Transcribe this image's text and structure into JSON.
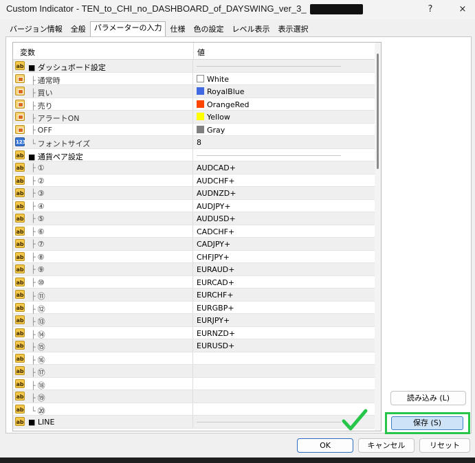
{
  "window": {
    "title": "Custom Indicator - TEN_to_CHI_no_DASHBOARD_of_DAYSWING_ver_3_",
    "help": "?",
    "close": "×"
  },
  "tabs": [
    {
      "label": "バージョン情報"
    },
    {
      "label": "全般"
    },
    {
      "label": "パラメーターの入力",
      "active": true
    },
    {
      "label": "仕様"
    },
    {
      "label": "色の設定"
    },
    {
      "label": "レベル表示"
    },
    {
      "label": "表示選択"
    }
  ],
  "grid": {
    "col_variable": "変数",
    "col_value": "値",
    "rows": [
      {
        "icon": "ab",
        "name": "■ ダッシュボード設定",
        "sub": false,
        "type": "line",
        "value": ""
      },
      {
        "icon": "color",
        "name": "通常時",
        "branch": "├",
        "sub": true,
        "type": "color",
        "swatch": "#ffffff",
        "value": "White"
      },
      {
        "icon": "color",
        "name": "買い",
        "branch": "├",
        "sub": true,
        "type": "color",
        "swatch": "#4169e1",
        "value": "RoyalBlue"
      },
      {
        "icon": "color",
        "name": "売り",
        "branch": "├",
        "sub": true,
        "type": "color",
        "swatch": "#ff4500",
        "value": "OrangeRed"
      },
      {
        "icon": "color",
        "name": "アラートON",
        "branch": "├",
        "sub": true,
        "type": "color",
        "swatch": "#ffff00",
        "value": "Yellow"
      },
      {
        "icon": "color",
        "name": "OFF",
        "branch": "├",
        "sub": true,
        "type": "color",
        "swatch": "#808080",
        "value": "Gray"
      },
      {
        "icon": "123",
        "name": "フォントサイズ",
        "branch": "└",
        "sub": true,
        "type": "text",
        "value": "8"
      },
      {
        "icon": "ab",
        "name": "■ 通貨ペア設定",
        "sub": false,
        "type": "line",
        "value": ""
      },
      {
        "icon": "ab",
        "name": "①",
        "branch": "├",
        "sub": true,
        "type": "text",
        "value": "AUDCAD+"
      },
      {
        "icon": "ab",
        "name": "②",
        "branch": "├",
        "sub": true,
        "type": "text",
        "value": "AUDCHF+"
      },
      {
        "icon": "ab",
        "name": "③",
        "branch": "├",
        "sub": true,
        "type": "text",
        "value": "AUDNZD+"
      },
      {
        "icon": "ab",
        "name": "④",
        "branch": "├",
        "sub": true,
        "type": "text",
        "value": "AUDJPY+"
      },
      {
        "icon": "ab",
        "name": "⑤",
        "branch": "├",
        "sub": true,
        "type": "text",
        "value": "AUDUSD+"
      },
      {
        "icon": "ab",
        "name": "⑥",
        "branch": "├",
        "sub": true,
        "type": "text",
        "value": "CADCHF+"
      },
      {
        "icon": "ab",
        "name": "⑦",
        "branch": "├",
        "sub": true,
        "type": "text",
        "value": "CADJPY+"
      },
      {
        "icon": "ab",
        "name": "⑧",
        "branch": "├",
        "sub": true,
        "type": "text",
        "value": "CHFJPY+"
      },
      {
        "icon": "ab",
        "name": "⑨",
        "branch": "├",
        "sub": true,
        "type": "text",
        "value": "EURAUD+"
      },
      {
        "icon": "ab",
        "name": "⑩",
        "branch": "├",
        "sub": true,
        "type": "text",
        "value": "EURCAD+"
      },
      {
        "icon": "ab",
        "name": "⑪",
        "branch": "├",
        "sub": true,
        "type": "text",
        "value": "EURCHF+"
      },
      {
        "icon": "ab",
        "name": "⑫",
        "branch": "├",
        "sub": true,
        "type": "text",
        "value": "EURGBP+"
      },
      {
        "icon": "ab",
        "name": "⑬",
        "branch": "├",
        "sub": true,
        "type": "text",
        "value": "EURJPY+"
      },
      {
        "icon": "ab",
        "name": "⑭",
        "branch": "├",
        "sub": true,
        "type": "text",
        "value": "EURNZD+"
      },
      {
        "icon": "ab",
        "name": "⑮",
        "branch": "├",
        "sub": true,
        "type": "text",
        "value": "EURUSD+"
      },
      {
        "icon": "ab",
        "name": "⑯",
        "branch": "├",
        "sub": true,
        "type": "text",
        "value": ""
      },
      {
        "icon": "ab",
        "name": "⑰",
        "branch": "├",
        "sub": true,
        "type": "text",
        "value": ""
      },
      {
        "icon": "ab",
        "name": "⑱",
        "branch": "├",
        "sub": true,
        "type": "text",
        "value": ""
      },
      {
        "icon": "ab",
        "name": "⑲",
        "branch": "├",
        "sub": true,
        "type": "text",
        "value": ""
      },
      {
        "icon": "ab",
        "name": "⑳",
        "branch": "└",
        "sub": true,
        "type": "text",
        "value": ""
      },
      {
        "icon": "ab",
        "name": "■ LINE",
        "sub": false,
        "type": "line",
        "value": ""
      }
    ]
  },
  "buttons": {
    "load": "読み込み (L)",
    "save": "保存 (S)",
    "ok": "OK",
    "cancel": "キャンセル",
    "reset": "リセット"
  },
  "colors": {
    "highlight_border": "#27c54a",
    "check_mark": "#27c54a",
    "save_background": "#cfe3f7"
  },
  "icons": {
    "string": "ab",
    "number": "123",
    "color": "color-palette-icon",
    "check": "check-mark-icon"
  }
}
